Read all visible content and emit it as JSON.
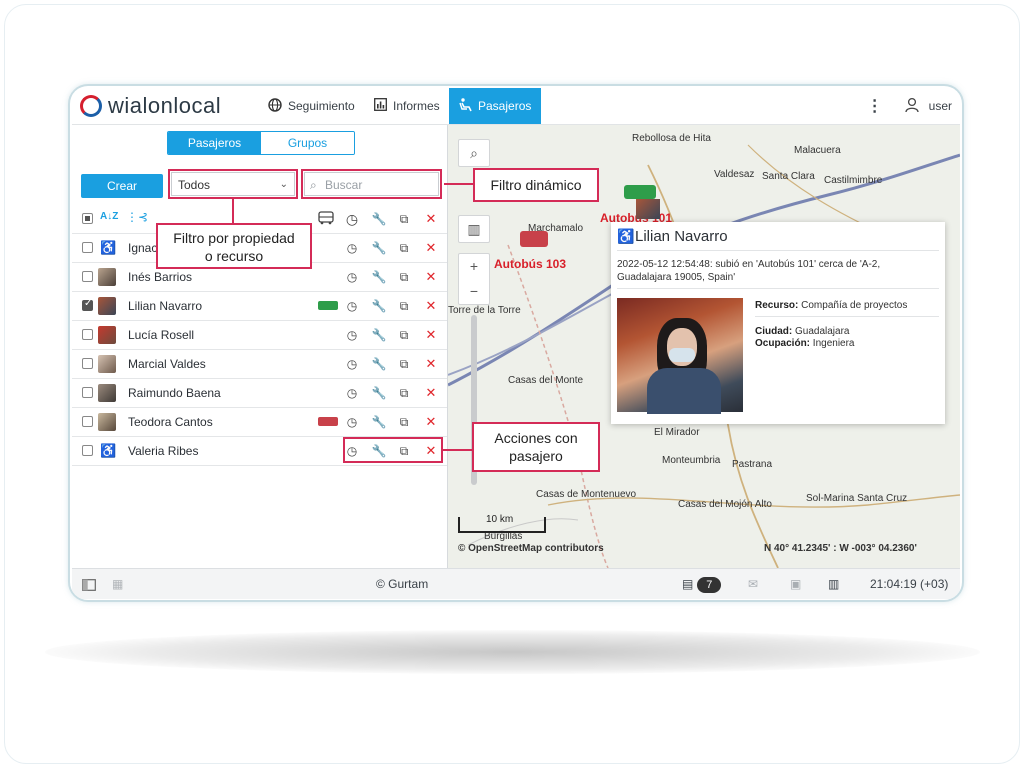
{
  "header": {
    "logo": "wialonlocal",
    "menu": [
      {
        "label": "Seguimiento",
        "icon": "globe-icon"
      },
      {
        "label": "Informes",
        "icon": "report-icon"
      },
      {
        "label": "Pasajeros",
        "icon": "passenger-icon",
        "active": true
      }
    ],
    "user": "user",
    "accent": "#1a9fe0"
  },
  "panel": {
    "tabs": [
      "Pasajeros",
      "Grupos"
    ],
    "create_label": "Crear",
    "filter_value": "Todos",
    "search_placeholder": "Buscar",
    "passengers": [
      {
        "name": "Ignacio",
        "checked": false
      },
      {
        "name": "Inés Barrios",
        "checked": false
      },
      {
        "name": "Lilian Navarro",
        "checked": true,
        "bus": "green"
      },
      {
        "name": "Lucía Rosell",
        "checked": false
      },
      {
        "name": "Marcial Valdes",
        "checked": false
      },
      {
        "name": "Raimundo Baena",
        "checked": false
      },
      {
        "name": "Teodora Cantos",
        "checked": false,
        "bus": "red"
      },
      {
        "name": "Valeria Ribes",
        "checked": false
      }
    ]
  },
  "map": {
    "places": [
      "Rebollosa de Hita",
      "Malacuera",
      "Valdesaz",
      "Santa Clara",
      "Castilmimbre",
      "Marchamalo",
      "Autobús 103",
      "Autobús 101",
      "Torre de la Torre",
      "Casas del Monte",
      "El Mirador",
      "Monteumbria",
      "Pastrana",
      "Casas de Montenuevo",
      "Casas del Mojón Alto",
      "Sol-Marina Santa Cruz",
      "Burgillas"
    ],
    "scale": "10 km",
    "attribution": "© OpenStreetMap contributors",
    "coords": "N 40° 41.2345' : W -003° 04.2360'"
  },
  "card": {
    "name": "Lilian Navarro",
    "message": "2022-05-12 12:54:48: subió en 'Autobús 101' cerca de 'A-2, Guadalajara 19005, Spain'",
    "resource_label": "Recurso:",
    "resource_value": "Compañía de proyectos",
    "city_label": "Ciudad:",
    "city_value": "Guadalajara",
    "job_label": "Ocupación:",
    "job_value": "Ingeniera"
  },
  "callouts": {
    "dynamic_filter": "Filtro dinámico",
    "property_filter_1": "Filtro por propiedad",
    "property_filter_2": "o recurso",
    "actions_1": "Acciones con",
    "actions_2": "pasajero"
  },
  "footer": {
    "copyright": "© Gurtam",
    "notifications": "7",
    "time": "21:04:19 (+03)"
  }
}
